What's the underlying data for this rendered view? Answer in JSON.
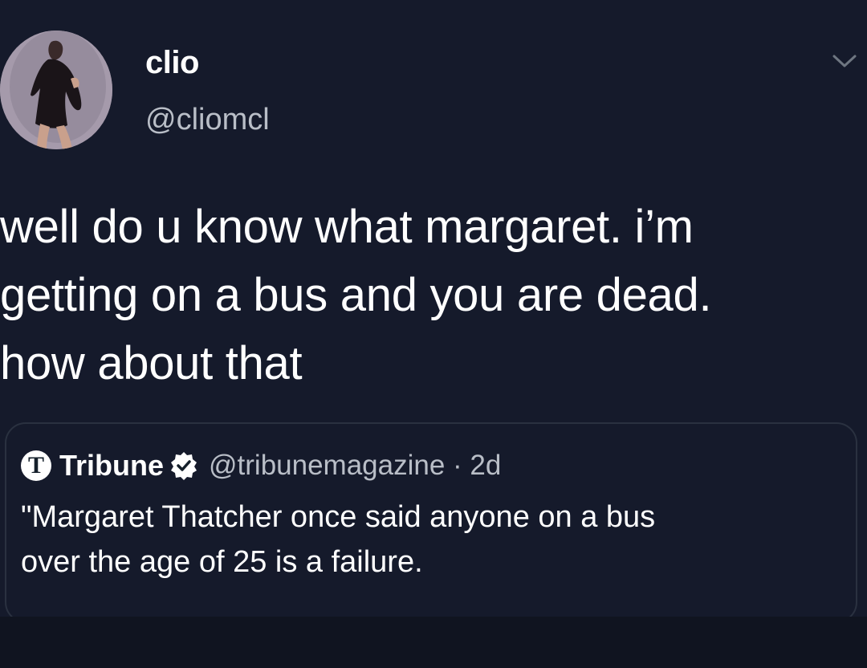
{
  "tweet": {
    "display_name": "clio",
    "handle": "@cliomcl",
    "text": "well do u know what margaret. i’m\ngetting on a bus and you are dead.\nhow about that"
  },
  "quoted_tweet": {
    "logo_letter": "T",
    "display_name": "Tribune",
    "handle_time": "@tribunemagazine · 2d",
    "text": "\"Margaret Thatcher once said anyone on a bus\nover the age of 25 is a failure."
  },
  "colors": {
    "background": "#151a2b",
    "text": "#ffffff",
    "secondary_text": "#b9bec7",
    "card_border": "#2a3140"
  }
}
